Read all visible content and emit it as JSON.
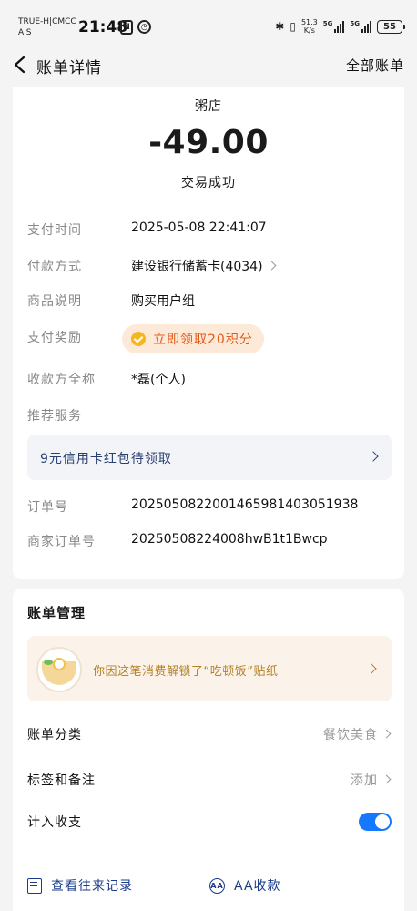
{
  "status_bar": {
    "carrier_1": "TRUE-H|CMCC",
    "carrier_2": "AIS",
    "time": "21:48",
    "speed_value": "51.3",
    "speed_unit": "K/s",
    "net_1": "5G",
    "net_2": "5G",
    "battery": "55"
  },
  "nav": {
    "title": "账单详情",
    "right_link": "全部账单"
  },
  "transaction": {
    "merchant": "粥店",
    "amount": "-49.00",
    "status": "交易成功"
  },
  "details": {
    "pay_time_label": "支付时间",
    "pay_time_value": "2025-05-08 22:41:07",
    "pay_method_label": "付款方式",
    "pay_method_value": "建设银行储蓄卡(4034)",
    "goods_label": "商品说明",
    "goods_value": "购买用户组",
    "reward_label": "支付奖励",
    "reward_value": "立即领取20积分",
    "payee_label": "收款方全称",
    "payee_value": "*磊(个人)",
    "recommend_label": "推荐服务",
    "promo_text": "9元信用卡红包待领取",
    "order_no_label": "订单号",
    "order_no_value": "2025050822001465981403051938",
    "merchant_order_label": "商家订单号",
    "merchant_order_value": "20250508224008hwB1t1Bwcp"
  },
  "management": {
    "title": "账单管理",
    "sticker_text": "你因这笔消费解锁了“吃顿饭”贴纸",
    "category_label": "账单分类",
    "category_value": "餐饮美食",
    "tags_label": "标签和备注",
    "tags_value": "添加",
    "count_label": "计入收支",
    "count_enabled": true,
    "history_label": "查看往来记录",
    "aa_label": "AA收款",
    "aa_icon_text": "AA"
  },
  "colors": {
    "accent_blue": "#1677ff",
    "reward_orange": "#e25a1a",
    "promo_navy": "#2a3f72",
    "sticker_gold": "#b5822a"
  }
}
